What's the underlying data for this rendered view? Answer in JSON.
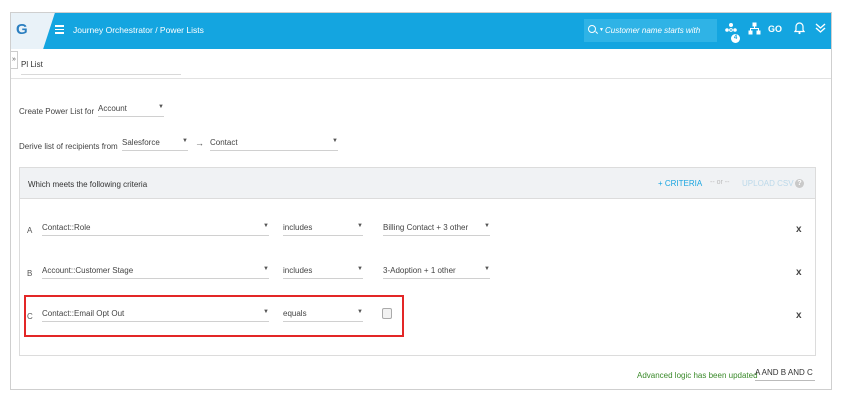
{
  "header": {
    "logo_letter": "G",
    "breadcrumb_title": "Journey Orchestrator / Power Lists",
    "search": {
      "placeholder": "Customer name starts with"
    },
    "notification_badge": "4",
    "go_label": "GO",
    "brand_color": "#14a5e0"
  },
  "tab": {
    "label": "Pl List"
  },
  "form": {
    "create_label": "Create Power List for",
    "create_value": "Account",
    "derive_label": "Derive list of recipients from",
    "derive_source": "Salesforce",
    "derive_target": "Contact"
  },
  "criteria": {
    "title": "Which meets the following criteria",
    "add_label": "+ CRITERIA",
    "or_label": "-- or --",
    "upload_label": "UPLOAD CSV",
    "help": "?",
    "remove_label": "x",
    "rows": [
      {
        "letter": "A",
        "field": "Contact::Role",
        "operator": "includes",
        "value": "Billing Contact + 3 other"
      },
      {
        "letter": "B",
        "field": "Account::Customer Stage",
        "operator": "includes",
        "value": "3-Adoption + 1 other"
      },
      {
        "letter": "C",
        "field": "Contact::Email Opt Out",
        "operator": "equals",
        "value": ""
      }
    ]
  },
  "advanced": {
    "message": "Advanced logic has been updated",
    "value": "A AND B AND C"
  },
  "icons": {
    "hamburger": "menu-icon",
    "search": "search-icon",
    "people": "people-icon",
    "hierarchy": "hierarchy-icon",
    "bell": "bell-icon",
    "chevron": "chevron-down-icon"
  }
}
